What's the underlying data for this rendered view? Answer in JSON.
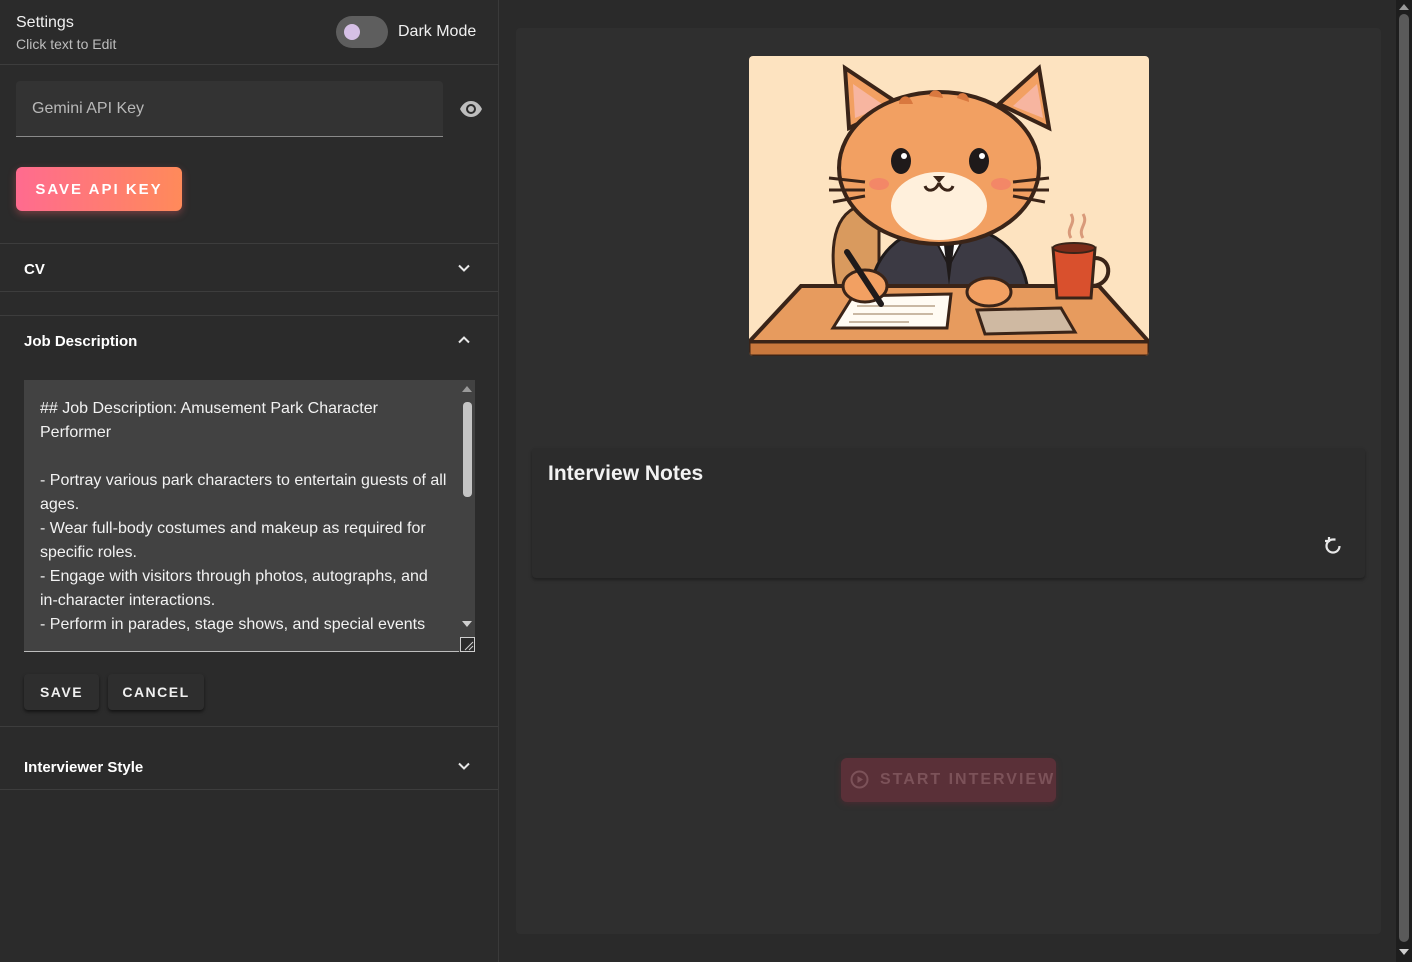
{
  "settings": {
    "title": "Settings",
    "subtitle": "Click text to Edit",
    "dark_mode_label": "Dark Mode",
    "dark_mode_on": false
  },
  "api_key": {
    "placeholder": "Gemini API Key",
    "value": "",
    "save_label": "SAVE API KEY"
  },
  "accordion": {
    "cv": {
      "title": "CV",
      "expanded": false
    },
    "job_description": {
      "title": "Job Description",
      "expanded": true,
      "text": "## Job Description: Amusement Park Character Performer\n\n- Portray various park characters to entertain guests of all ages.\n- Wear full-body costumes and makeup as required for specific roles.\n- Engage with visitors through photos, autographs, and in-character interactions.\n- Perform in parades, stage shows, and special events",
      "save_label": "SAVE",
      "cancel_label": "CANCEL"
    },
    "interviewer_style": {
      "title": "Interviewer Style",
      "expanded": false
    }
  },
  "main": {
    "notes_title": "Interview Notes",
    "start_label": "START INTERVIEW",
    "start_disabled": true
  },
  "colors": {
    "accent_start": "#ff6b8f",
    "accent_end": "#ff8a5a",
    "background": "#2a2a2a"
  },
  "icons": {
    "password_visibility": "eye-icon",
    "collapse": "chevron-down-icon",
    "expand": "chevron-up-icon",
    "refresh": "refresh-icon",
    "play": "play-circle-icon"
  }
}
